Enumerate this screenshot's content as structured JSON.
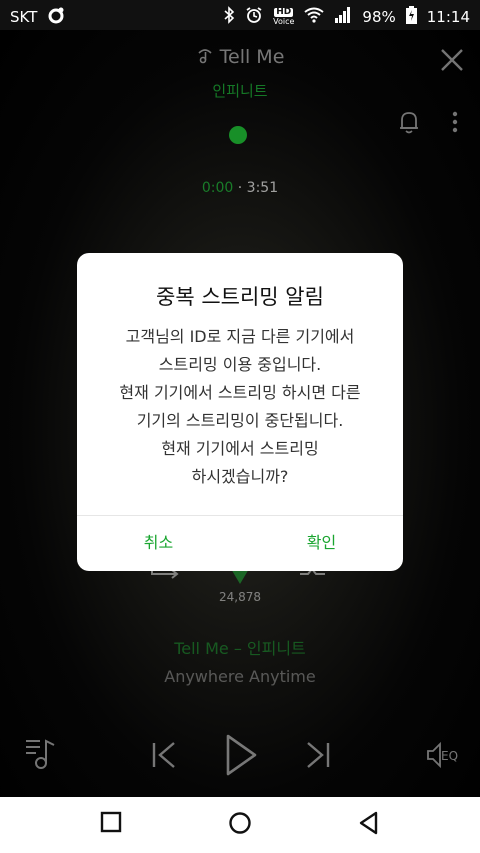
{
  "status_bar": {
    "carrier": "SKT",
    "hd_label": "HD",
    "voice_label": "Voice",
    "battery": "98%",
    "time": "11:14"
  },
  "player": {
    "title": "Tell Me",
    "artist": "인피니트",
    "time_current": "0:00",
    "time_separator": "·",
    "time_total": "3:51",
    "like_count": "24,878",
    "song_line": "Tell Me – 인피니트",
    "album_line": "Anywhere Anytime",
    "eq_label": "EQ",
    "accent_color": "#1fc33b"
  },
  "dialog": {
    "title": "중복 스트리밍 알림",
    "message_lines": [
      "고객님의 ID로 지금 다른 기기에서",
      "스트리밍 이용 중입니다.",
      "현재 기기에서 스트리밍 하시면 다른",
      "기기의 스트리밍이 중단됩니다.",
      "현재 기기에서 스트리밍",
      "하시겠습니까?"
    ],
    "cancel_label": "취소",
    "confirm_label": "확인",
    "button_color": "#1aa530"
  }
}
